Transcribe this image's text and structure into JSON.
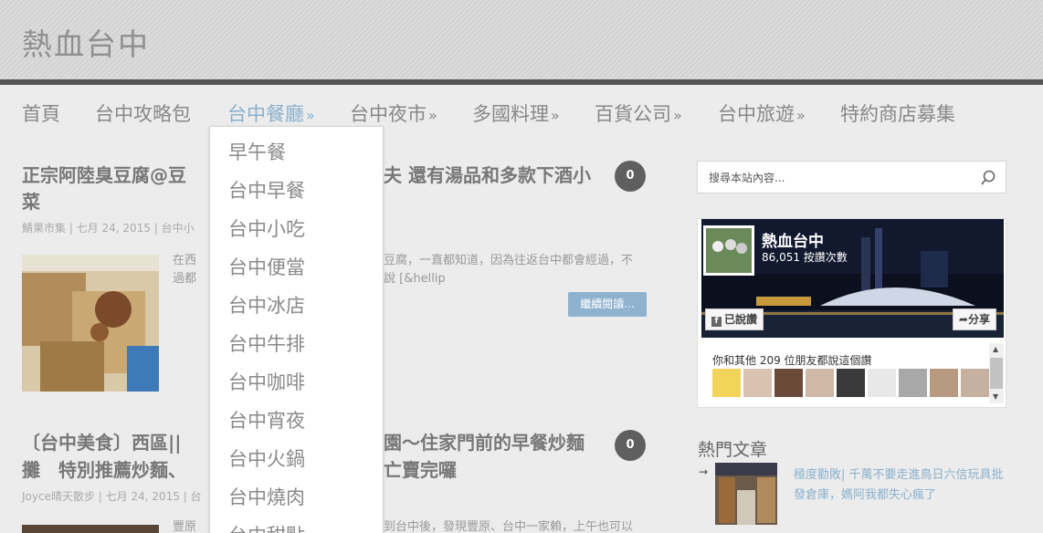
{
  "site": {
    "title": "熱血台中"
  },
  "nav": {
    "items": [
      {
        "label": "首頁"
      },
      {
        "label": "台中攻略包"
      },
      {
        "label": "台中餐廳",
        "arrow": "»"
      },
      {
        "label": "台中夜市",
        "arrow": "»"
      },
      {
        "label": "多國料理",
        "arrow": "»"
      },
      {
        "label": "百貨公司",
        "arrow": "»"
      },
      {
        "label": "台中旅遊",
        "arrow": "»"
      },
      {
        "label": "特約商店募集"
      }
    ]
  },
  "dropdown": {
    "items": [
      "早午餐",
      "台中早餐",
      "台中小吃",
      "台中便當",
      "台中冰店",
      "台中牛排",
      "台中咖啡",
      "台中宵夜",
      "台中火鍋",
      "台中燒肉",
      "台中甜點"
    ]
  },
  "posts": [
    {
      "title_left": "正宗阿陸臭豆腐@豆",
      "title_right": "夫 還有湯品和多款下酒小",
      "title_line2": "菜",
      "meta": "鯖果市集 | 七月 24, 2015 | 台中小",
      "comments": "0",
      "excerpt_line1_left": "在西",
      "excerpt_line1_right": "豆腐，一直都知道，因為往返台中都會經過，不",
      "excerpt_line2_left": "過都",
      "excerpt_line2_right": "說 [&hellip",
      "read_more": "繼續閱讀..."
    },
    {
      "title_left": "〔台中美食〕西區||",
      "title_right": "園～住家門前的早餐炒麵",
      "title_line2_left": "攤　特別推薦炒麵、",
      "title_line2_right": "亡賣完囉",
      "meta": "Joyce晴天散步 | 七月 24, 2015 | 台",
      "comments": "0",
      "excerpt_left": "豐原",
      "excerpt_right": "到台中後，發現豐原、台中一家賴，上午也可以"
    }
  ],
  "sidebar": {
    "search_placeholder": "搜尋本站內容...",
    "fb": {
      "name": "熱血台中",
      "likes": "86,051 按讚次數",
      "liked_button": "已說讚",
      "share_button": "分享",
      "friends_text": "你和其他 209 位朋友都說這個讚"
    },
    "popular_title": "熱門文章",
    "popular_arrow": "→",
    "popular_link": "極度勸敗| 千萬不要走進鳥日六信玩具批發倉庫，媽阿我都失心瘋了"
  },
  "colors": {
    "accent": "#8ab0cd",
    "header_bar": "#555555",
    "bubble": "#5f5f5f",
    "button": "#8fb2cf"
  }
}
